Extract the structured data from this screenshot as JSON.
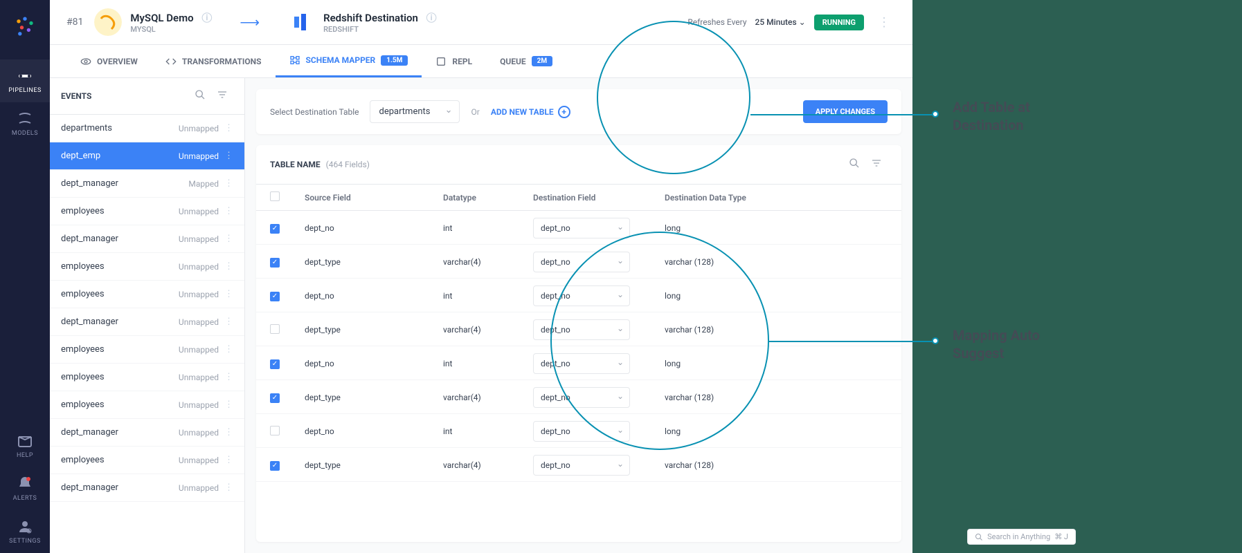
{
  "sidebar": {
    "items": [
      {
        "label": "PIPELINES",
        "active": true
      },
      {
        "label": "MODELS"
      },
      {
        "label": "HELP"
      },
      {
        "label": "ALERTS"
      },
      {
        "label": "SETTINGS"
      }
    ]
  },
  "header": {
    "pipeline_id": "#81",
    "source_title": "MySQL Demo",
    "source_subtitle": "MYSQL",
    "dest_title": "Redshift Destination",
    "dest_subtitle": "REDSHIFT",
    "refresh_label": "Refreshes Every",
    "refresh_value": "25 Minutes",
    "status": "RUNNING"
  },
  "tabs": [
    {
      "label": "OVERVIEW"
    },
    {
      "label": "TRANSFORMATIONS"
    },
    {
      "label": "SCHEMA MAPPER",
      "badge": "1.5M",
      "active": true
    },
    {
      "label": "REPL"
    },
    {
      "label": "QUEUE",
      "badge": "2M"
    }
  ],
  "events": {
    "title": "EVENTS",
    "items": [
      {
        "name": "departments",
        "status": "Unmapped"
      },
      {
        "name": "dept_emp",
        "status": "Unmapped",
        "selected": true
      },
      {
        "name": "dept_manager",
        "status": "Mapped"
      },
      {
        "name": "employees",
        "status": "Unmapped"
      },
      {
        "name": "dept_manager",
        "status": "Unmapped"
      },
      {
        "name": "employees",
        "status": "Unmapped"
      },
      {
        "name": "employees",
        "status": "Unmapped"
      },
      {
        "name": "dept_manager",
        "status": "Unmapped"
      },
      {
        "name": "employees",
        "status": "Unmapped"
      },
      {
        "name": "employees",
        "status": "Unmapped"
      },
      {
        "name": "employees",
        "status": "Unmapped"
      },
      {
        "name": "dept_manager",
        "status": "Unmapped"
      },
      {
        "name": "employees",
        "status": "Unmapped"
      },
      {
        "name": "dept_manager",
        "status": "Unmapped"
      }
    ]
  },
  "dest_selector": {
    "label": "Select Destination Table",
    "value": "departments",
    "or": "Or",
    "add_table": "ADD NEW TABLE",
    "apply": "APPLY CHANGES"
  },
  "table": {
    "name_label": "TABLE NAME",
    "field_count": "(464 Fields)",
    "headers": {
      "source": "Source Field",
      "datatype": "Datatype",
      "destination": "Destination Field",
      "dest_type": "Destination Data Type"
    },
    "rows": [
      {
        "checked": true,
        "source": "dept_no",
        "datatype": "int",
        "dest": "dept_no",
        "dest_type": "long"
      },
      {
        "checked": true,
        "source": "dept_type",
        "datatype": "varchar(4)",
        "dest": "dept_no",
        "dest_type": "varchar (128)"
      },
      {
        "checked": true,
        "source": "dept_no",
        "datatype": "int",
        "dest": "dept_no",
        "dest_type": "long"
      },
      {
        "checked": false,
        "source": "dept_type",
        "datatype": "varchar(4)",
        "dest": "dept_no",
        "dest_type": "varchar (128)"
      },
      {
        "checked": true,
        "source": "dept_no",
        "datatype": "int",
        "dest": "dept_no",
        "dest_type": "long"
      },
      {
        "checked": true,
        "source": "dept_type",
        "datatype": "varchar(4)",
        "dest": "dept_no",
        "dest_type": "varchar (128)"
      },
      {
        "checked": false,
        "source": "dept_no",
        "datatype": "int",
        "dest": "dept_no",
        "dest_type": "long"
      },
      {
        "checked": true,
        "source": "dept_type",
        "datatype": "varchar(4)",
        "dest": "dept_no",
        "dest_type": "varchar (128)"
      }
    ]
  },
  "annotations": {
    "add_table": "Add Table at Destination",
    "auto_suggest": "Mapping Auto Suggest"
  },
  "search": {
    "placeholder": "Search in Anything",
    "shortcut": "⌘ J"
  }
}
